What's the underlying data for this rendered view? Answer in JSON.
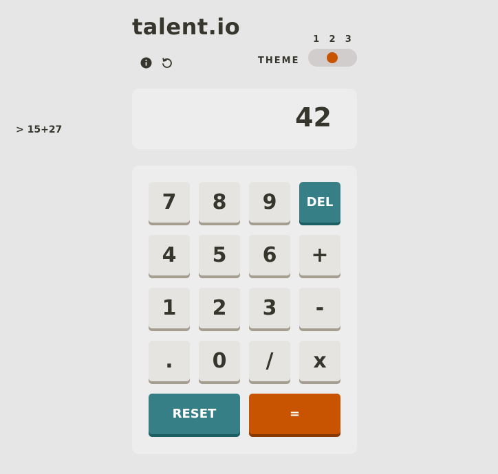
{
  "header": {
    "brand": "talent.io",
    "info_icon": "info-icon",
    "history_icon": "history-icon",
    "theme_label": "THEME",
    "theme_options": [
      "1",
      "2",
      "3"
    ],
    "theme_selected": 2
  },
  "history": {
    "entry": "> 15+27"
  },
  "display": {
    "value": "42"
  },
  "keys": {
    "k7": "7",
    "k8": "8",
    "k9": "9",
    "del": "DEL",
    "k4": "4",
    "k5": "5",
    "k6": "6",
    "plus": "+",
    "k1": "1",
    "k2": "2",
    "k3": "3",
    "minus": "-",
    "dot": ".",
    "k0": "0",
    "divide": "/",
    "multiply": "x",
    "reset": "RESET",
    "equals": "="
  },
  "colors": {
    "background": "#e6e6e6",
    "panel": "#ededed",
    "key": "#e5e4e1",
    "key_shadow": "#a69d91",
    "teal": "#377f86",
    "orange": "#c85402",
    "text": "#36362c"
  }
}
